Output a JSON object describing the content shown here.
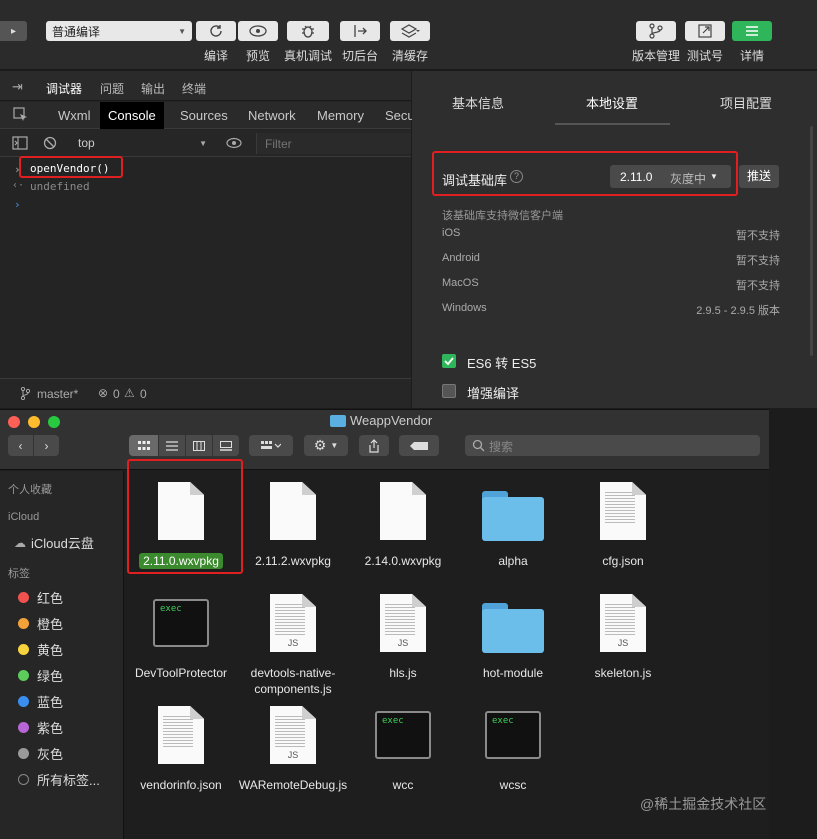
{
  "toolbar": {
    "left_cut_label": "▸",
    "compile_mode": "普通编译",
    "buttons": {
      "compile": "编译",
      "preview": "预览",
      "device_debug": "真机调试",
      "background": "切后台",
      "clear_cache": "清缓存",
      "version_mgmt": "版本管理",
      "test_account": "测试号",
      "details": "详情"
    }
  },
  "devtools": {
    "top_tabs": [
      "调试器",
      "问题",
      "输出",
      "终端"
    ],
    "panel_tabs": [
      "Wxml",
      "Console",
      "Sources",
      "Network",
      "Memory",
      "Secu"
    ],
    "active_panel_tab": "Console",
    "context": "top",
    "filter_placeholder": "Filter",
    "console_lines": {
      "input": "openVendor()",
      "output": "undefined"
    },
    "status": {
      "branch": "master*",
      "errors": "0",
      "warnings": "0"
    }
  },
  "settings": {
    "tabs": [
      "基本信息",
      "本地设置",
      "项目配置"
    ],
    "active_tab": "本地设置",
    "lib_label": "调试基础库",
    "lib_version": "2.11.0",
    "lib_state": "灰度中",
    "push_button": "推送",
    "support_heading": "该基础库支持微信客户端",
    "platforms": [
      {
        "name": "iOS",
        "value": "暂不支持"
      },
      {
        "name": "Android",
        "value": "暂不支持"
      },
      {
        "name": "MacOS",
        "value": "暂不支持"
      },
      {
        "name": "Windows",
        "value": "2.9.5 - 2.9.5 版本"
      }
    ],
    "options": [
      {
        "label": "ES6 转 ES5",
        "checked": true
      },
      {
        "label": "增强编译",
        "checked": false
      }
    ]
  },
  "finder": {
    "title": "WeappVendor",
    "search_placeholder": "搜索",
    "sidebar": {
      "favorites_heading": "个人收藏",
      "icloud_heading": "iCloud",
      "icloud_drive": "iCloud云盘",
      "tags_heading": "标签",
      "tags": [
        {
          "name": "红色",
          "color": "#f0524f"
        },
        {
          "name": "橙色",
          "color": "#f5a13a"
        },
        {
          "name": "黄色",
          "color": "#f6d33c"
        },
        {
          "name": "绿色",
          "color": "#5ccc5a"
        },
        {
          "name": "蓝色",
          "color": "#3a8ef0"
        },
        {
          "name": "紫色",
          "color": "#b866d6"
        },
        {
          "name": "灰色",
          "color": "#9a9a9a"
        }
      ],
      "all_tags": "所有标签..."
    },
    "files": [
      {
        "name": "2.11.0.wxvpkg",
        "kind": "doc"
      },
      {
        "name": "2.11.2.wxvpkg",
        "kind": "doc"
      },
      {
        "name": "2.14.0.wxvpkg",
        "kind": "doc"
      },
      {
        "name": "alpha",
        "kind": "folder"
      },
      {
        "name": "cfg.json",
        "kind": "text"
      },
      {
        "name": "DevToolProtector",
        "kind": "exec"
      },
      {
        "name": "devtools-native-components.js",
        "kind": "js"
      },
      {
        "name": "hls.js",
        "kind": "js"
      },
      {
        "name": "hot-module",
        "kind": "folder"
      },
      {
        "name": "skeleton.js",
        "kind": "js"
      },
      {
        "name": "vendorinfo.json",
        "kind": "text"
      },
      {
        "name": "WARemoteDebug.js",
        "kind": "js"
      },
      {
        "name": "wcc",
        "kind": "exec"
      },
      {
        "name": "wcsc",
        "kind": "exec"
      }
    ],
    "exec_badge": "exec",
    "js_badge": "JS"
  },
  "watermark": "@稀土掘金技术社区",
  "colors": {
    "highlight": "#e02020",
    "accent_green": "#2fb55a",
    "selected_label": "#3c8a2e"
  }
}
